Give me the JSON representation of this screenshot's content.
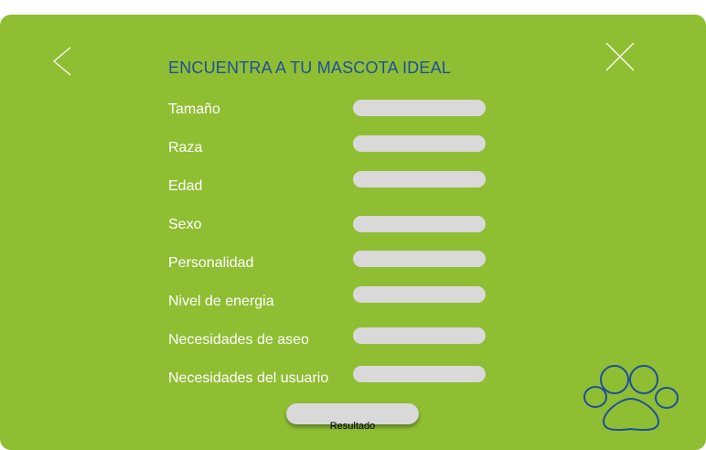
{
  "header": {
    "title": "ENCUENTRA A TU MASCOTA IDEAL"
  },
  "icons": {
    "back": "chevron-left-icon",
    "close": "close-icon",
    "decoration": "paw-print-icon"
  },
  "form": {
    "fields": [
      {
        "label": "Tamaño",
        "value": ""
      },
      {
        "label": "Raza",
        "value": ""
      },
      {
        "label": "Edad",
        "value": ""
      },
      {
        "label": "Sexo",
        "value": ""
      },
      {
        "label": "Personalidad",
        "value": ""
      },
      {
        "label": "Nivel de energia",
        "value": ""
      },
      {
        "label": "Necesidades de aseo",
        "value": ""
      },
      {
        "label": "Necesidades del usuario",
        "value": ""
      }
    ],
    "submit_label": "Resultado"
  },
  "colors": {
    "background": "#8fbe33",
    "title": "#1f4f9a",
    "label": "#ffffff",
    "field": "#d9d9d9",
    "paw_outline": "#1f4f9a"
  }
}
